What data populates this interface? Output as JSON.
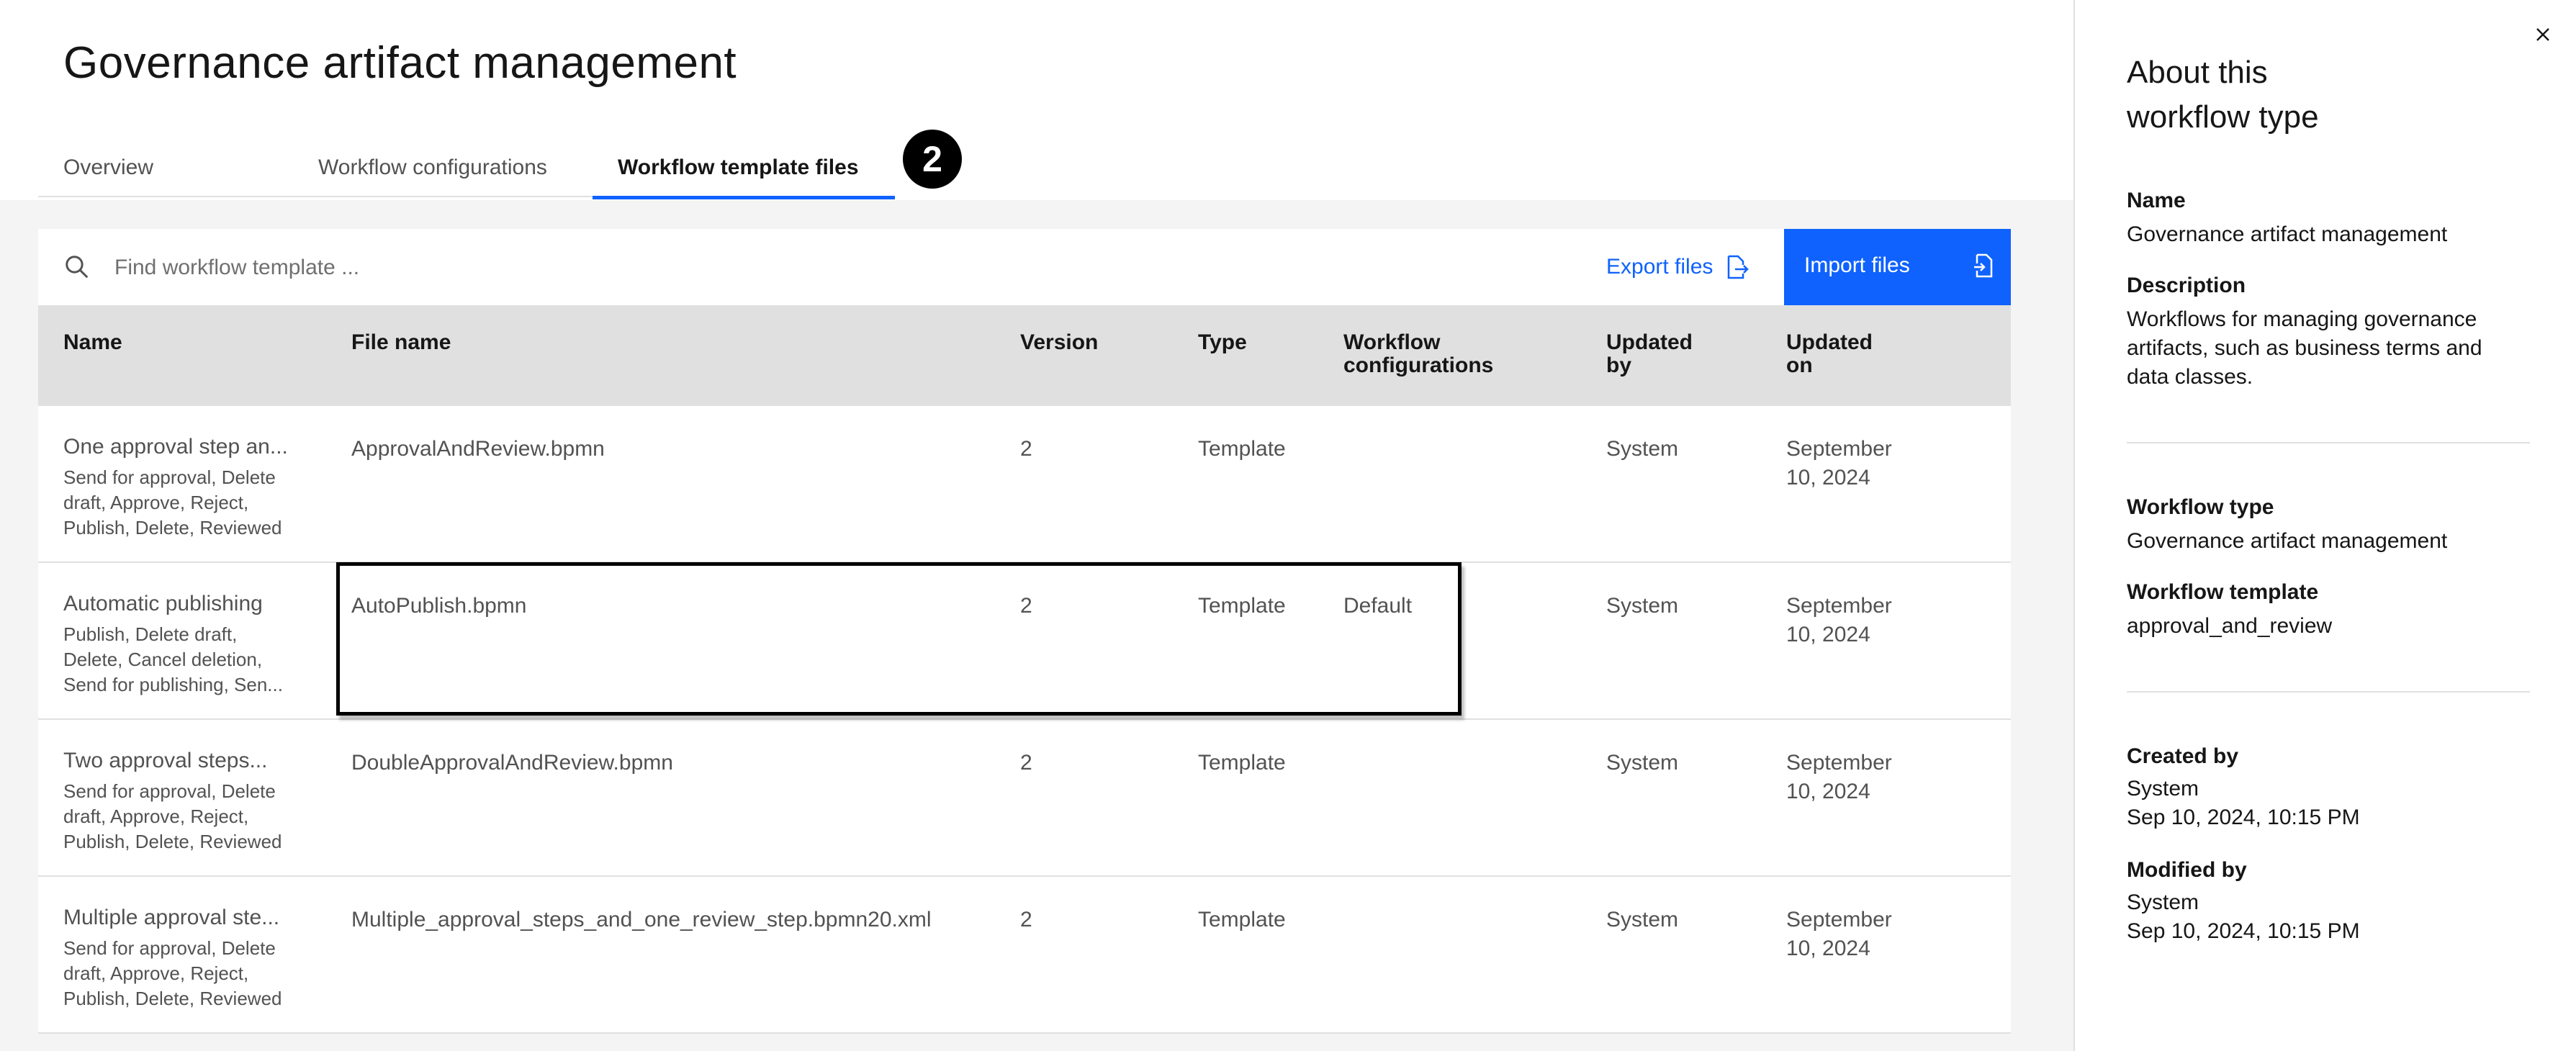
{
  "page": {
    "title": "Governance artifact management"
  },
  "tabs": [
    {
      "label": "Overview",
      "active": false
    },
    {
      "label": "Workflow configurations",
      "active": false
    },
    {
      "label": "Workflow template files",
      "active": true
    }
  ],
  "step_badge": "2",
  "toolbar": {
    "search_placeholder": "Find workflow template ...",
    "export_label": "Export files",
    "import_label": "Import files"
  },
  "table": {
    "headers": {
      "name": "Name",
      "file_name": "File name",
      "version": "Version",
      "type": "Type",
      "workflow_configurations_1": "Workflow",
      "workflow_configurations_2": "configurations",
      "updated_by_1": "Updated",
      "updated_by_2": "by",
      "updated_on_1": "Updated",
      "updated_on_2": "on"
    },
    "rows": [
      {
        "name": "One approval step an...",
        "description": "Send for approval, Delete draft, Approve, Reject, Publish, Delete, Reviewed",
        "file_name": "ApprovalAndReview.bpmn",
        "version": "2",
        "type": "Template",
        "workflow_configurations": "",
        "updated_by": "System",
        "updated_on_1": "September",
        "updated_on_2": "10, 2024"
      },
      {
        "name": "Automatic publishing",
        "description": "Publish, Delete draft, Delete, Cancel deletion, Send for publishing, Sen...",
        "file_name": "AutoPublish.bpmn",
        "version": "2",
        "type": "Template",
        "workflow_configurations": "Default",
        "updated_by": "System",
        "updated_on_1": "September",
        "updated_on_2": "10, 2024"
      },
      {
        "name": "Two approval steps...",
        "description": "Send for approval, Delete draft, Approve, Reject, Publish, Delete, Reviewed",
        "file_name": "DoubleApprovalAndReview.bpmn",
        "version": "2",
        "type": "Template",
        "workflow_configurations": "",
        "updated_by": "System",
        "updated_on_1": "September",
        "updated_on_2": "10, 2024"
      },
      {
        "name": "Multiple approval ste...",
        "description": "Send for approval, Delete draft, Approve, Reject, Publish, Delete, Reviewed",
        "file_name": "Multiple_approval_steps_and_one_review_step.bpmn20.xml",
        "version": "2",
        "type": "Template",
        "workflow_configurations": "",
        "updated_by": "System",
        "updated_on_1": "September",
        "updated_on_2": "10, 2024"
      }
    ]
  },
  "panel": {
    "title_line1": "About this",
    "title_line2": "workflow type",
    "name_label": "Name",
    "name_value": "Governance artifact management",
    "description_label": "Description",
    "description_value": "Workflows for managing governance artifacts, such as business terms and data classes.",
    "workflow_type_label": "Workflow type",
    "workflow_type_value": "Governance artifact management",
    "workflow_template_label": "Workflow template",
    "workflow_template_value": "approval_and_review",
    "created_by_label": "Created by",
    "created_by_user": "System",
    "created_by_date": "Sep 10, 2024, 10:15 PM",
    "modified_by_label": "Modified by",
    "modified_by_user": "System",
    "modified_by_date": "Sep 10, 2024, 10:15 PM"
  },
  "colors": {
    "accent": "#0f62fe",
    "header_bg": "#e0e0e0",
    "page_bg": "#f4f4f4"
  },
  "icons": {
    "search": "search-icon",
    "export": "export-icon",
    "import": "import-icon",
    "close": "close-icon"
  }
}
